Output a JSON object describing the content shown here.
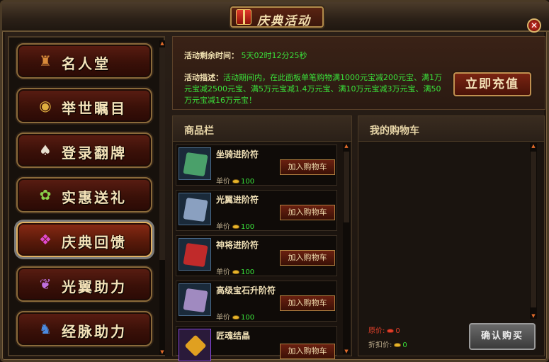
{
  "window": {
    "title": "庆典活动",
    "close_symbol": "✕"
  },
  "sidebar": {
    "items": [
      {
        "label": "名人堂",
        "icon": "bust-icon",
        "glyph": "♜",
        "color": "#d88a3a",
        "active": false
      },
      {
        "label": "举世瞩目",
        "icon": "eye-icon",
        "glyph": "◉",
        "color": "#e0b040",
        "active": false
      },
      {
        "label": "登录翻牌",
        "icon": "card-icon",
        "glyph": "♠",
        "color": "#e8e0d0",
        "active": false
      },
      {
        "label": "实惠送礼",
        "icon": "gift-icon",
        "glyph": "✿",
        "color": "#8ad04a",
        "active": false
      },
      {
        "label": "庆典回馈",
        "icon": "gift-box-icon",
        "glyph": "❖",
        "color": "#e04ad0",
        "active": true
      },
      {
        "label": "光翼助力",
        "icon": "wings-icon",
        "glyph": "❦",
        "color": "#c070e0",
        "active": false
      },
      {
        "label": "经脉助力",
        "icon": "meridian-icon",
        "glyph": "♞",
        "color": "#4a8ae0",
        "active": false
      }
    ]
  },
  "info": {
    "time_label": "活动剩余时间：",
    "time_value": "5天02时12分25秒",
    "desc_label": "活动描述：",
    "desc_text": "活动期间内，在此面板单笔购物满1000元宝减200元宝、满1万元宝减2500元宝、满5万元宝减1.4万元宝、满10万元宝减3万元宝、满50万元宝减16万元宝！",
    "recharge_button": "立即充值"
  },
  "goods": {
    "title": "商品栏",
    "price_label": "单价",
    "add_button": "加入购物车",
    "items": [
      {
        "name": "坐骑进阶符",
        "price": "100",
        "color": "#4aa06a"
      },
      {
        "name": "光翼进阶符",
        "price": "100",
        "color": "#8aa0c0"
      },
      {
        "name": "神将进阶符",
        "price": "100",
        "color": "#c02a2a"
      },
      {
        "name": "高级宝石升阶符",
        "price": "100",
        "color": "#a08ac0"
      },
      {
        "name": "匠魂结晶",
        "price": "",
        "color": "#e0a020"
      }
    ]
  },
  "cart": {
    "title": "我的购物车",
    "original_label": "原价:",
    "original_value": "0",
    "discount_label": "折扣价:",
    "discount_value": "0",
    "confirm_button": "确认购买"
  },
  "colors": {
    "accent_green": "#3ae03a",
    "gold_text": "#f4e2b8",
    "panel_bg": "#1a130e"
  }
}
